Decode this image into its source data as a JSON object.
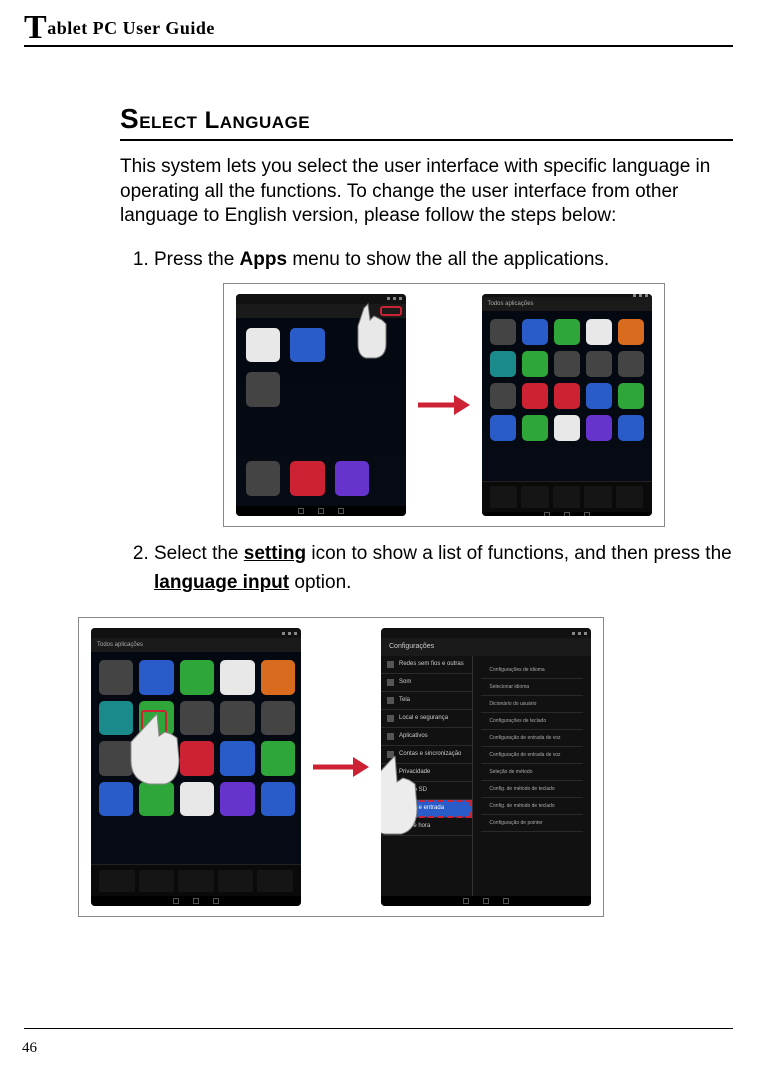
{
  "header": {
    "title_rest": "ablet PC User Guide"
  },
  "section": {
    "title": "Select Language",
    "intro": "This system lets you select the user interface with specific language in operating all the functions. To change the user interface from other language to English version, please follow the steps below:"
  },
  "steps": {
    "s1_pre": "Press the ",
    "s1_b": "Apps",
    "s1_post": " menu to show the all the applications.",
    "s2_pre": "Select the ",
    "s2_b1": "setting",
    "s2_mid": " icon to show a list of functions, and then press the ",
    "s2_b2": "language input",
    "s2_post": " option."
  },
  "fig1": {
    "left_header": "",
    "right_header": "Todos aplicações"
  },
  "fig2": {
    "left_header": "Todos aplicações",
    "settings_title": "Configurações",
    "settings_items": [
      "Redes sem fios e outras",
      "Som",
      "Tela",
      "Local e segurança",
      "Aplicativos",
      "Contas e sincronização",
      "Privacidade",
      "Cartão SD",
      "Idioma e entrada",
      "Data e hora"
    ],
    "settings_right": [
      "Configurações de idioma",
      "Selecionar idioma",
      "Dicionário do usuário",
      "Configurações de teclado",
      "Configuração de entrada de voz",
      "Configuração de entrada de voz",
      "Seleção de método",
      "Config. de método de teclado",
      "Config. de método de teclado",
      "Configuração de pointer"
    ]
  },
  "page_number": "46"
}
